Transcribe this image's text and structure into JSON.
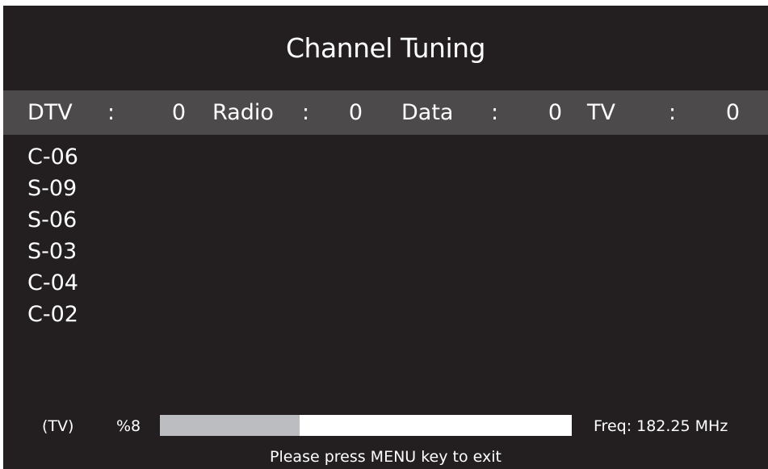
{
  "title": "Channel Tuning",
  "stats": [
    {
      "label": "DTV",
      "separator": ":",
      "value": "0"
    },
    {
      "label": "Radio",
      "separator": ":",
      "value": "0"
    },
    {
      "label": "Data",
      "separator": ":",
      "value": "0"
    },
    {
      "label": "TV",
      "separator": ":",
      "value": "0"
    }
  ],
  "channels": [
    "C-06",
    "S-09",
    "S-06",
    "S-03",
    "C-04",
    "C-02"
  ],
  "footer": {
    "mode": "(TV)",
    "percent_text": "%8",
    "progress_fraction": 0.34,
    "freq_text": "Freq: 182.25 MHz",
    "exit_hint": "Please press MENU key to exit"
  },
  "colors": {
    "background": "#231f20",
    "stats_bar": "#4d4a4b",
    "progress_fill": "#bcbdc0",
    "progress_track": "#ffffff",
    "text": "#ffffff"
  }
}
